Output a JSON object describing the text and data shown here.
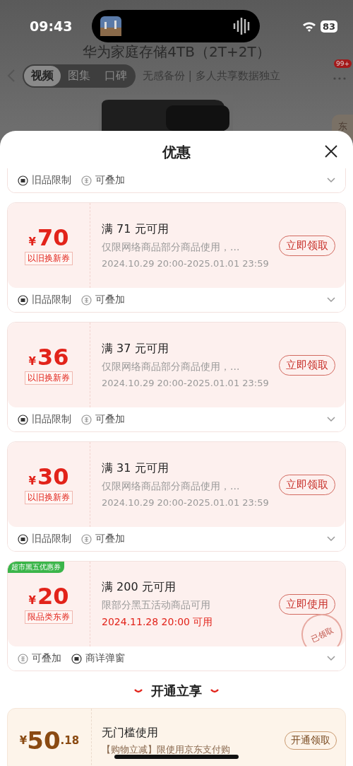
{
  "status_bar": {
    "time": "09:43",
    "battery": "83"
  },
  "product_page": {
    "title": "华为家庭存储4TB（2T+2T）",
    "subtitle": "无感备份 | 多人共享数据独立",
    "media_tabs": [
      {
        "label": "视频",
        "selected": true
      },
      {
        "label": "图集",
        "selected": false
      },
      {
        "label": "口碑",
        "selected": false
      }
    ],
    "badge": "99+",
    "side_tab": "东"
  },
  "sheet": {
    "title": "优惠",
    "coupons": [
      {
        "kind": "partial",
        "tags": [
          {
            "kind": "old",
            "label": "旧品限制"
          },
          {
            "kind": "stack",
            "label": "可叠加"
          }
        ]
      },
      {
        "kind": "coupon",
        "currency": "¥",
        "amount": "70",
        "type": "以旧换新券",
        "condition": "满 71 元可用",
        "description": "仅限网络商品部分商品使用，...",
        "validity": "2024.10.29 20:00-2025.01.01 23:59",
        "validity_highlight": false,
        "button": "立即领取",
        "tags": [
          {
            "kind": "old",
            "label": "旧品限制"
          },
          {
            "kind": "stack",
            "label": "可叠加"
          }
        ]
      },
      {
        "kind": "coupon",
        "currency": "¥",
        "amount": "36",
        "type": "以旧换新券",
        "condition": "满 37 元可用",
        "description": "仅限网络商品部分商品使用，...",
        "validity": "2024.10.29 20:00-2025.01.01 23:59",
        "validity_highlight": false,
        "button": "立即领取",
        "tags": [
          {
            "kind": "old",
            "label": "旧品限制"
          },
          {
            "kind": "stack",
            "label": "可叠加"
          }
        ]
      },
      {
        "kind": "coupon",
        "currency": "¥",
        "amount": "30",
        "type": "以旧换新券",
        "condition": "满 31 元可用",
        "description": "仅限网络商品部分商品使用，...",
        "validity": "2024.10.29 20:00-2025.01.01 23:59",
        "validity_highlight": false,
        "button": "立即领取",
        "tags": [
          {
            "kind": "old",
            "label": "旧品限制"
          },
          {
            "kind": "stack",
            "label": "可叠加"
          }
        ]
      },
      {
        "kind": "coupon",
        "badge": "超市黑五优惠券",
        "currency": "¥",
        "amount": "20",
        "type": "限品类东券",
        "condition": "满 200 元可用",
        "description": "限部分黑五活动商品可用",
        "validity": "2024.11.28 20:00 可用",
        "validity_highlight": true,
        "button": "立即使用",
        "stamp": "已领取",
        "tags": [
          {
            "kind": "stack",
            "label": "可叠加"
          },
          {
            "kind": "popup",
            "label": "商详弹窗"
          }
        ]
      }
    ],
    "section_title": "开通立享",
    "member_coupon": {
      "currency": "¥",
      "amount": "50",
      "decimal": ".18",
      "condition": "无门槛使用",
      "description": "【购物立减】限使用京东支付购",
      "button": "开通领取"
    }
  }
}
